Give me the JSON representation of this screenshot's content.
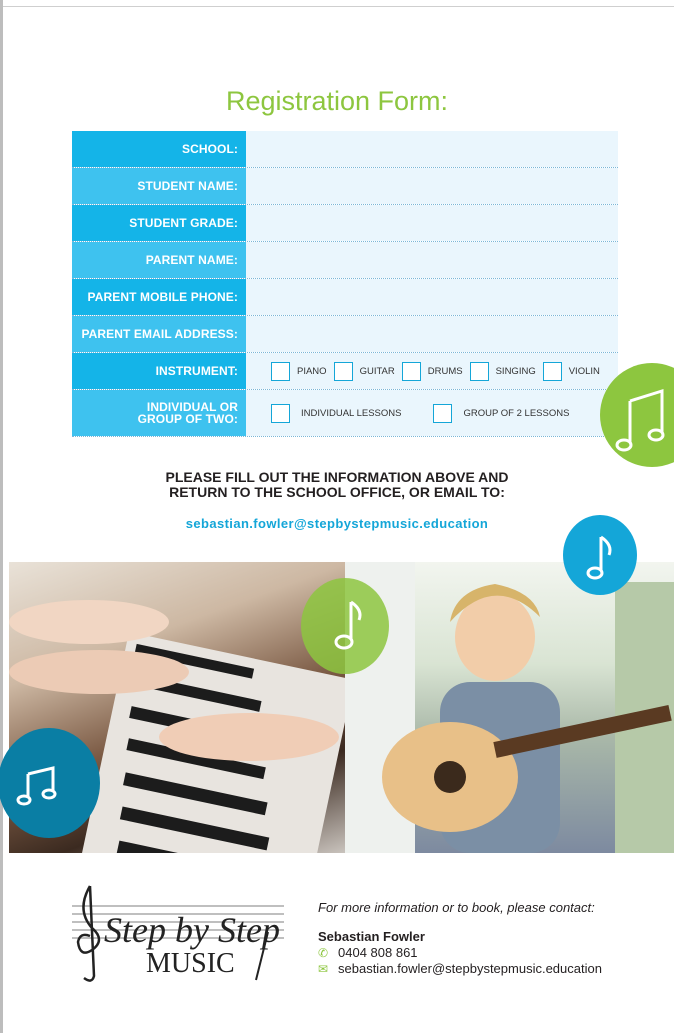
{
  "form": {
    "title": "Registration Form:",
    "fields": [
      {
        "label": "SCHOOL:"
      },
      {
        "label": "STUDENT NAME:"
      },
      {
        "label": "STUDENT GRADE:"
      },
      {
        "label": "PARENT NAME:"
      },
      {
        "label": "PARENT MOBILE PHONE:"
      },
      {
        "label": "PARENT EMAIL ADDRESS:"
      }
    ],
    "instrument": {
      "label": "INSTRUMENT:",
      "options": [
        "PIANO",
        "GUITAR",
        "DRUMS",
        "SINGING",
        "VIOLIN"
      ]
    },
    "group": {
      "label_line1": "INDIVIDUAL OR",
      "label_line2": "GROUP OF TWO:",
      "options": [
        "INDIVIDUAL LESSONS",
        "GROUP OF 2 LESSONS"
      ]
    }
  },
  "instructions": {
    "line1": "PLEASE FILL OUT THE INFORMATION ABOVE AND",
    "line2": "RETURN TO THE SCHOOL OFFICE, OR EMAIL TO:",
    "email": "sebastian.fowler@stepbystepmusic.education"
  },
  "logo": {
    "text1": "Step by Step",
    "text2": "MUSIC"
  },
  "contact": {
    "lead": "For more information or to book, please contact:",
    "name": "Sebastian Fowler",
    "phone": "0404 808 861",
    "email": "sebastian.fowler@stepbystepmusic.education",
    "phone_icon": "phone-icon",
    "email_icon": "envelope-icon"
  },
  "colors": {
    "title_green": "#8dc63f",
    "label_blue": "#14b4e8",
    "field_bg": "#eaf6fd",
    "teal": "#0a7ea4"
  }
}
